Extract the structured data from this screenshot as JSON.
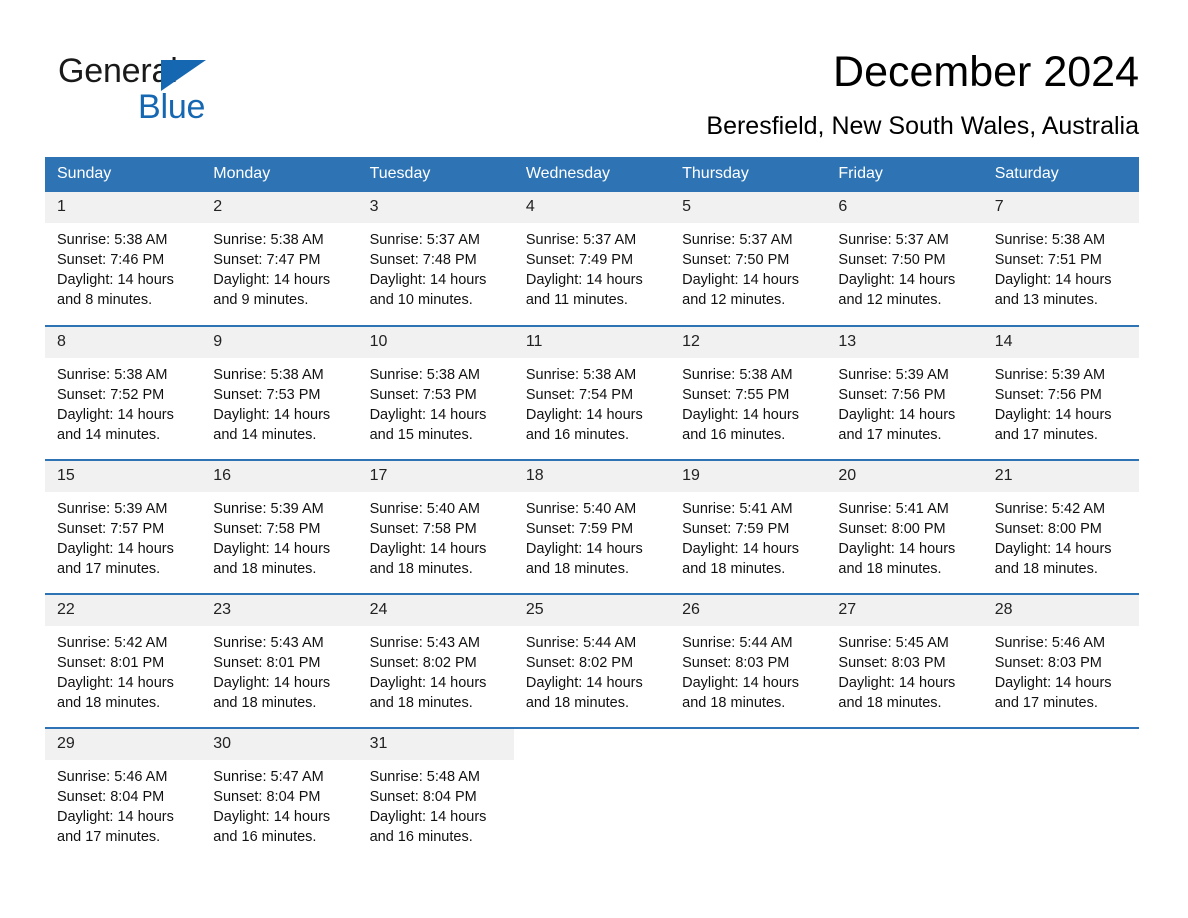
{
  "brand": {
    "name_part1": "General",
    "name_part2": "Blue",
    "accent_color": "#1567b2"
  },
  "header": {
    "title": "December 2024",
    "subtitle": "Beresfield, New South Wales, Australia"
  },
  "calendar": {
    "header_bg": "#2e74b5",
    "daynum_bg": "#f1f1f1",
    "weekday_headers": [
      "Sunday",
      "Monday",
      "Tuesday",
      "Wednesday",
      "Thursday",
      "Friday",
      "Saturday"
    ],
    "weeks": [
      [
        {
          "day": "1",
          "sunrise": "Sunrise: 5:38 AM",
          "sunset": "Sunset: 7:46 PM",
          "daylight": "Daylight: 14 hours and 8 minutes."
        },
        {
          "day": "2",
          "sunrise": "Sunrise: 5:38 AM",
          "sunset": "Sunset: 7:47 PM",
          "daylight": "Daylight: 14 hours and 9 minutes."
        },
        {
          "day": "3",
          "sunrise": "Sunrise: 5:37 AM",
          "sunset": "Sunset: 7:48 PM",
          "daylight": "Daylight: 14 hours and 10 minutes."
        },
        {
          "day": "4",
          "sunrise": "Sunrise: 5:37 AM",
          "sunset": "Sunset: 7:49 PM",
          "daylight": "Daylight: 14 hours and 11 minutes."
        },
        {
          "day": "5",
          "sunrise": "Sunrise: 5:37 AM",
          "sunset": "Sunset: 7:50 PM",
          "daylight": "Daylight: 14 hours and 12 minutes."
        },
        {
          "day": "6",
          "sunrise": "Sunrise: 5:37 AM",
          "sunset": "Sunset: 7:50 PM",
          "daylight": "Daylight: 14 hours and 12 minutes."
        },
        {
          "day": "7",
          "sunrise": "Sunrise: 5:38 AM",
          "sunset": "Sunset: 7:51 PM",
          "daylight": "Daylight: 14 hours and 13 minutes."
        }
      ],
      [
        {
          "day": "8",
          "sunrise": "Sunrise: 5:38 AM",
          "sunset": "Sunset: 7:52 PM",
          "daylight": "Daylight: 14 hours and 14 minutes."
        },
        {
          "day": "9",
          "sunrise": "Sunrise: 5:38 AM",
          "sunset": "Sunset: 7:53 PM",
          "daylight": "Daylight: 14 hours and 14 minutes."
        },
        {
          "day": "10",
          "sunrise": "Sunrise: 5:38 AM",
          "sunset": "Sunset: 7:53 PM",
          "daylight": "Daylight: 14 hours and 15 minutes."
        },
        {
          "day": "11",
          "sunrise": "Sunrise: 5:38 AM",
          "sunset": "Sunset: 7:54 PM",
          "daylight": "Daylight: 14 hours and 16 minutes."
        },
        {
          "day": "12",
          "sunrise": "Sunrise: 5:38 AM",
          "sunset": "Sunset: 7:55 PM",
          "daylight": "Daylight: 14 hours and 16 minutes."
        },
        {
          "day": "13",
          "sunrise": "Sunrise: 5:39 AM",
          "sunset": "Sunset: 7:56 PM",
          "daylight": "Daylight: 14 hours and 17 minutes."
        },
        {
          "day": "14",
          "sunrise": "Sunrise: 5:39 AM",
          "sunset": "Sunset: 7:56 PM",
          "daylight": "Daylight: 14 hours and 17 minutes."
        }
      ],
      [
        {
          "day": "15",
          "sunrise": "Sunrise: 5:39 AM",
          "sunset": "Sunset: 7:57 PM",
          "daylight": "Daylight: 14 hours and 17 minutes."
        },
        {
          "day": "16",
          "sunrise": "Sunrise: 5:39 AM",
          "sunset": "Sunset: 7:58 PM",
          "daylight": "Daylight: 14 hours and 18 minutes."
        },
        {
          "day": "17",
          "sunrise": "Sunrise: 5:40 AM",
          "sunset": "Sunset: 7:58 PM",
          "daylight": "Daylight: 14 hours and 18 minutes."
        },
        {
          "day": "18",
          "sunrise": "Sunrise: 5:40 AM",
          "sunset": "Sunset: 7:59 PM",
          "daylight": "Daylight: 14 hours and 18 minutes."
        },
        {
          "day": "19",
          "sunrise": "Sunrise: 5:41 AM",
          "sunset": "Sunset: 7:59 PM",
          "daylight": "Daylight: 14 hours and 18 minutes."
        },
        {
          "day": "20",
          "sunrise": "Sunrise: 5:41 AM",
          "sunset": "Sunset: 8:00 PM",
          "daylight": "Daylight: 14 hours and 18 minutes."
        },
        {
          "day": "21",
          "sunrise": "Sunrise: 5:42 AM",
          "sunset": "Sunset: 8:00 PM",
          "daylight": "Daylight: 14 hours and 18 minutes."
        }
      ],
      [
        {
          "day": "22",
          "sunrise": "Sunrise: 5:42 AM",
          "sunset": "Sunset: 8:01 PM",
          "daylight": "Daylight: 14 hours and 18 minutes."
        },
        {
          "day": "23",
          "sunrise": "Sunrise: 5:43 AM",
          "sunset": "Sunset: 8:01 PM",
          "daylight": "Daylight: 14 hours and 18 minutes."
        },
        {
          "day": "24",
          "sunrise": "Sunrise: 5:43 AM",
          "sunset": "Sunset: 8:02 PM",
          "daylight": "Daylight: 14 hours and 18 minutes."
        },
        {
          "day": "25",
          "sunrise": "Sunrise: 5:44 AM",
          "sunset": "Sunset: 8:02 PM",
          "daylight": "Daylight: 14 hours and 18 minutes."
        },
        {
          "day": "26",
          "sunrise": "Sunrise: 5:44 AM",
          "sunset": "Sunset: 8:03 PM",
          "daylight": "Daylight: 14 hours and 18 minutes."
        },
        {
          "day": "27",
          "sunrise": "Sunrise: 5:45 AM",
          "sunset": "Sunset: 8:03 PM",
          "daylight": "Daylight: 14 hours and 18 minutes."
        },
        {
          "day": "28",
          "sunrise": "Sunrise: 5:46 AM",
          "sunset": "Sunset: 8:03 PM",
          "daylight": "Daylight: 14 hours and 17 minutes."
        }
      ],
      [
        {
          "day": "29",
          "sunrise": "Sunrise: 5:46 AM",
          "sunset": "Sunset: 8:04 PM",
          "daylight": "Daylight: 14 hours and 17 minutes."
        },
        {
          "day": "30",
          "sunrise": "Sunrise: 5:47 AM",
          "sunset": "Sunset: 8:04 PM",
          "daylight": "Daylight: 14 hours and 16 minutes."
        },
        {
          "day": "31",
          "sunrise": "Sunrise: 5:48 AM",
          "sunset": "Sunset: 8:04 PM",
          "daylight": "Daylight: 14 hours and 16 minutes."
        },
        {
          "day": "",
          "sunrise": "",
          "sunset": "",
          "daylight": ""
        },
        {
          "day": "",
          "sunrise": "",
          "sunset": "",
          "daylight": ""
        },
        {
          "day": "",
          "sunrise": "",
          "sunset": "",
          "daylight": ""
        },
        {
          "day": "",
          "sunrise": "",
          "sunset": "",
          "daylight": ""
        }
      ]
    ]
  }
}
